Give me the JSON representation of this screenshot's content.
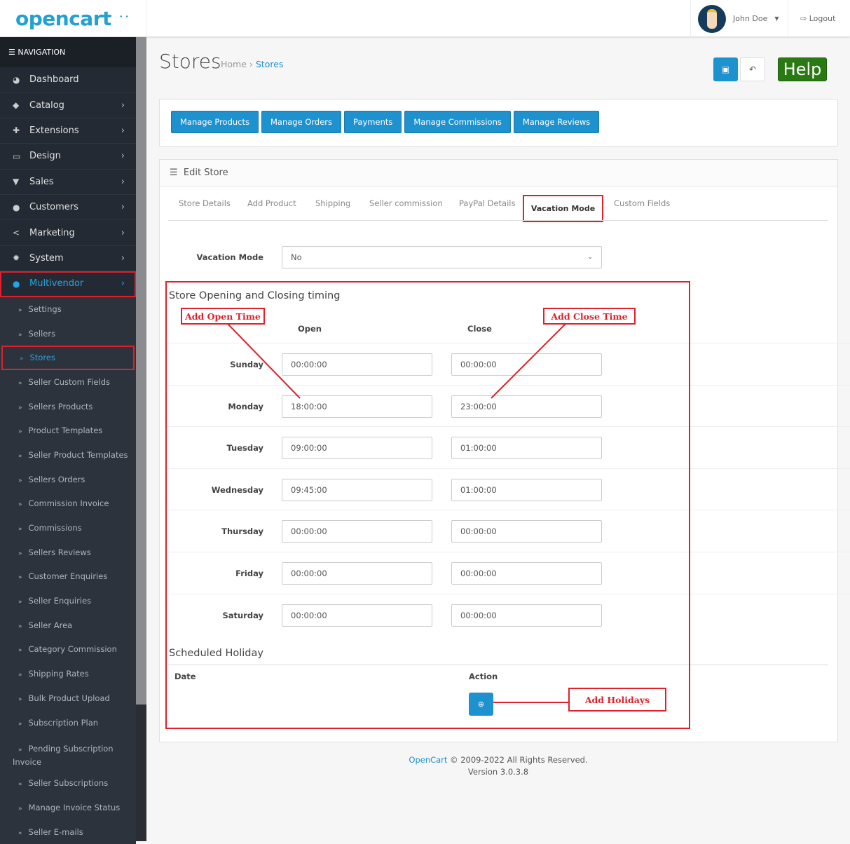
{
  "header": {
    "logo": "opencart",
    "user": "John Doe",
    "logout": "Logout"
  },
  "sidebar": {
    "heading": "NAVIGATION",
    "items": [
      {
        "label": "Dashboard",
        "icon": "dashboard-icon",
        "g": "◕"
      },
      {
        "label": "Catalog",
        "icon": "tags-icon",
        "g": "◆"
      },
      {
        "label": "Extensions",
        "icon": "puzzle-icon",
        "g": "✚"
      },
      {
        "label": "Design",
        "icon": "monitor-icon",
        "g": "▭"
      },
      {
        "label": "Sales",
        "icon": "cart-icon",
        "g": "▼"
      },
      {
        "label": "Customers",
        "icon": "user-icon",
        "g": "●"
      },
      {
        "label": "Marketing",
        "icon": "share-icon",
        "g": "<"
      },
      {
        "label": "System",
        "icon": "cog-icon",
        "g": "✹"
      },
      {
        "label": "Multivendor",
        "icon": "user-icon",
        "g": "●"
      }
    ],
    "sub": [
      "Settings",
      "Sellers",
      "Stores",
      "Seller Custom Fields",
      "Sellers Products",
      "Product Templates",
      "Seller Product Templates",
      "Sellers Orders",
      "Commission Invoice",
      "Commissions",
      "Sellers Reviews",
      "Customer Enquiries",
      "Seller Enquiries",
      "Seller Area",
      "Category Commission",
      "Shipping Rates",
      "Bulk Product Upload",
      "Subscription Plan",
      "Pending Subscription Invoice",
      "Seller Subscriptions",
      "Manage Invoice Status",
      "Seller E-mails"
    ]
  },
  "page": {
    "title": "Stores",
    "breadcrumb": [
      "Home",
      "Stores"
    ],
    "help": "Help"
  },
  "manage_buttons": [
    "Manage Products",
    "Manage Orders",
    "Payments",
    "Manage Commissions",
    "Manage Reviews"
  ],
  "panel_title": "Edit Store",
  "tabs": [
    "Store Details",
    "Add Product",
    "Shipping",
    "Seller commission",
    "PayPal Details",
    "Vacation Mode",
    "Custom Fields"
  ],
  "vacation": {
    "label": "Vacation Mode",
    "value": "No"
  },
  "timing": {
    "heading": "Store Opening and Closing timing",
    "open": "Open",
    "close": "Close",
    "days": [
      {
        "day": "Sunday",
        "open": "00:00:00",
        "close": "00:00:00"
      },
      {
        "day": "Monday",
        "open": "18:00:00",
        "close": "23:00:00"
      },
      {
        "day": "Tuesday",
        "open": "09:00:00",
        "close": "01:00:00"
      },
      {
        "day": "Wednesday",
        "open": "09:45:00",
        "close": "01:00:00"
      },
      {
        "day": "Thursday",
        "open": "00:00:00",
        "close": "00:00:00"
      },
      {
        "day": "Friday",
        "open": "00:00:00",
        "close": "00:00:00"
      },
      {
        "day": "Saturday",
        "open": "00:00:00",
        "close": "00:00:00"
      }
    ]
  },
  "holiday": {
    "heading": "Scheduled Holiday",
    "date": "Date",
    "action": "Action"
  },
  "annotations": {
    "open": "Add Open Time",
    "close": "Add Close Time",
    "holidays": "Add Holidays"
  },
  "footer": {
    "brand": "OpenCart",
    "copy": " © 2009-2022 All Rights Reserved.",
    "version": "Version 3.0.3.8"
  }
}
